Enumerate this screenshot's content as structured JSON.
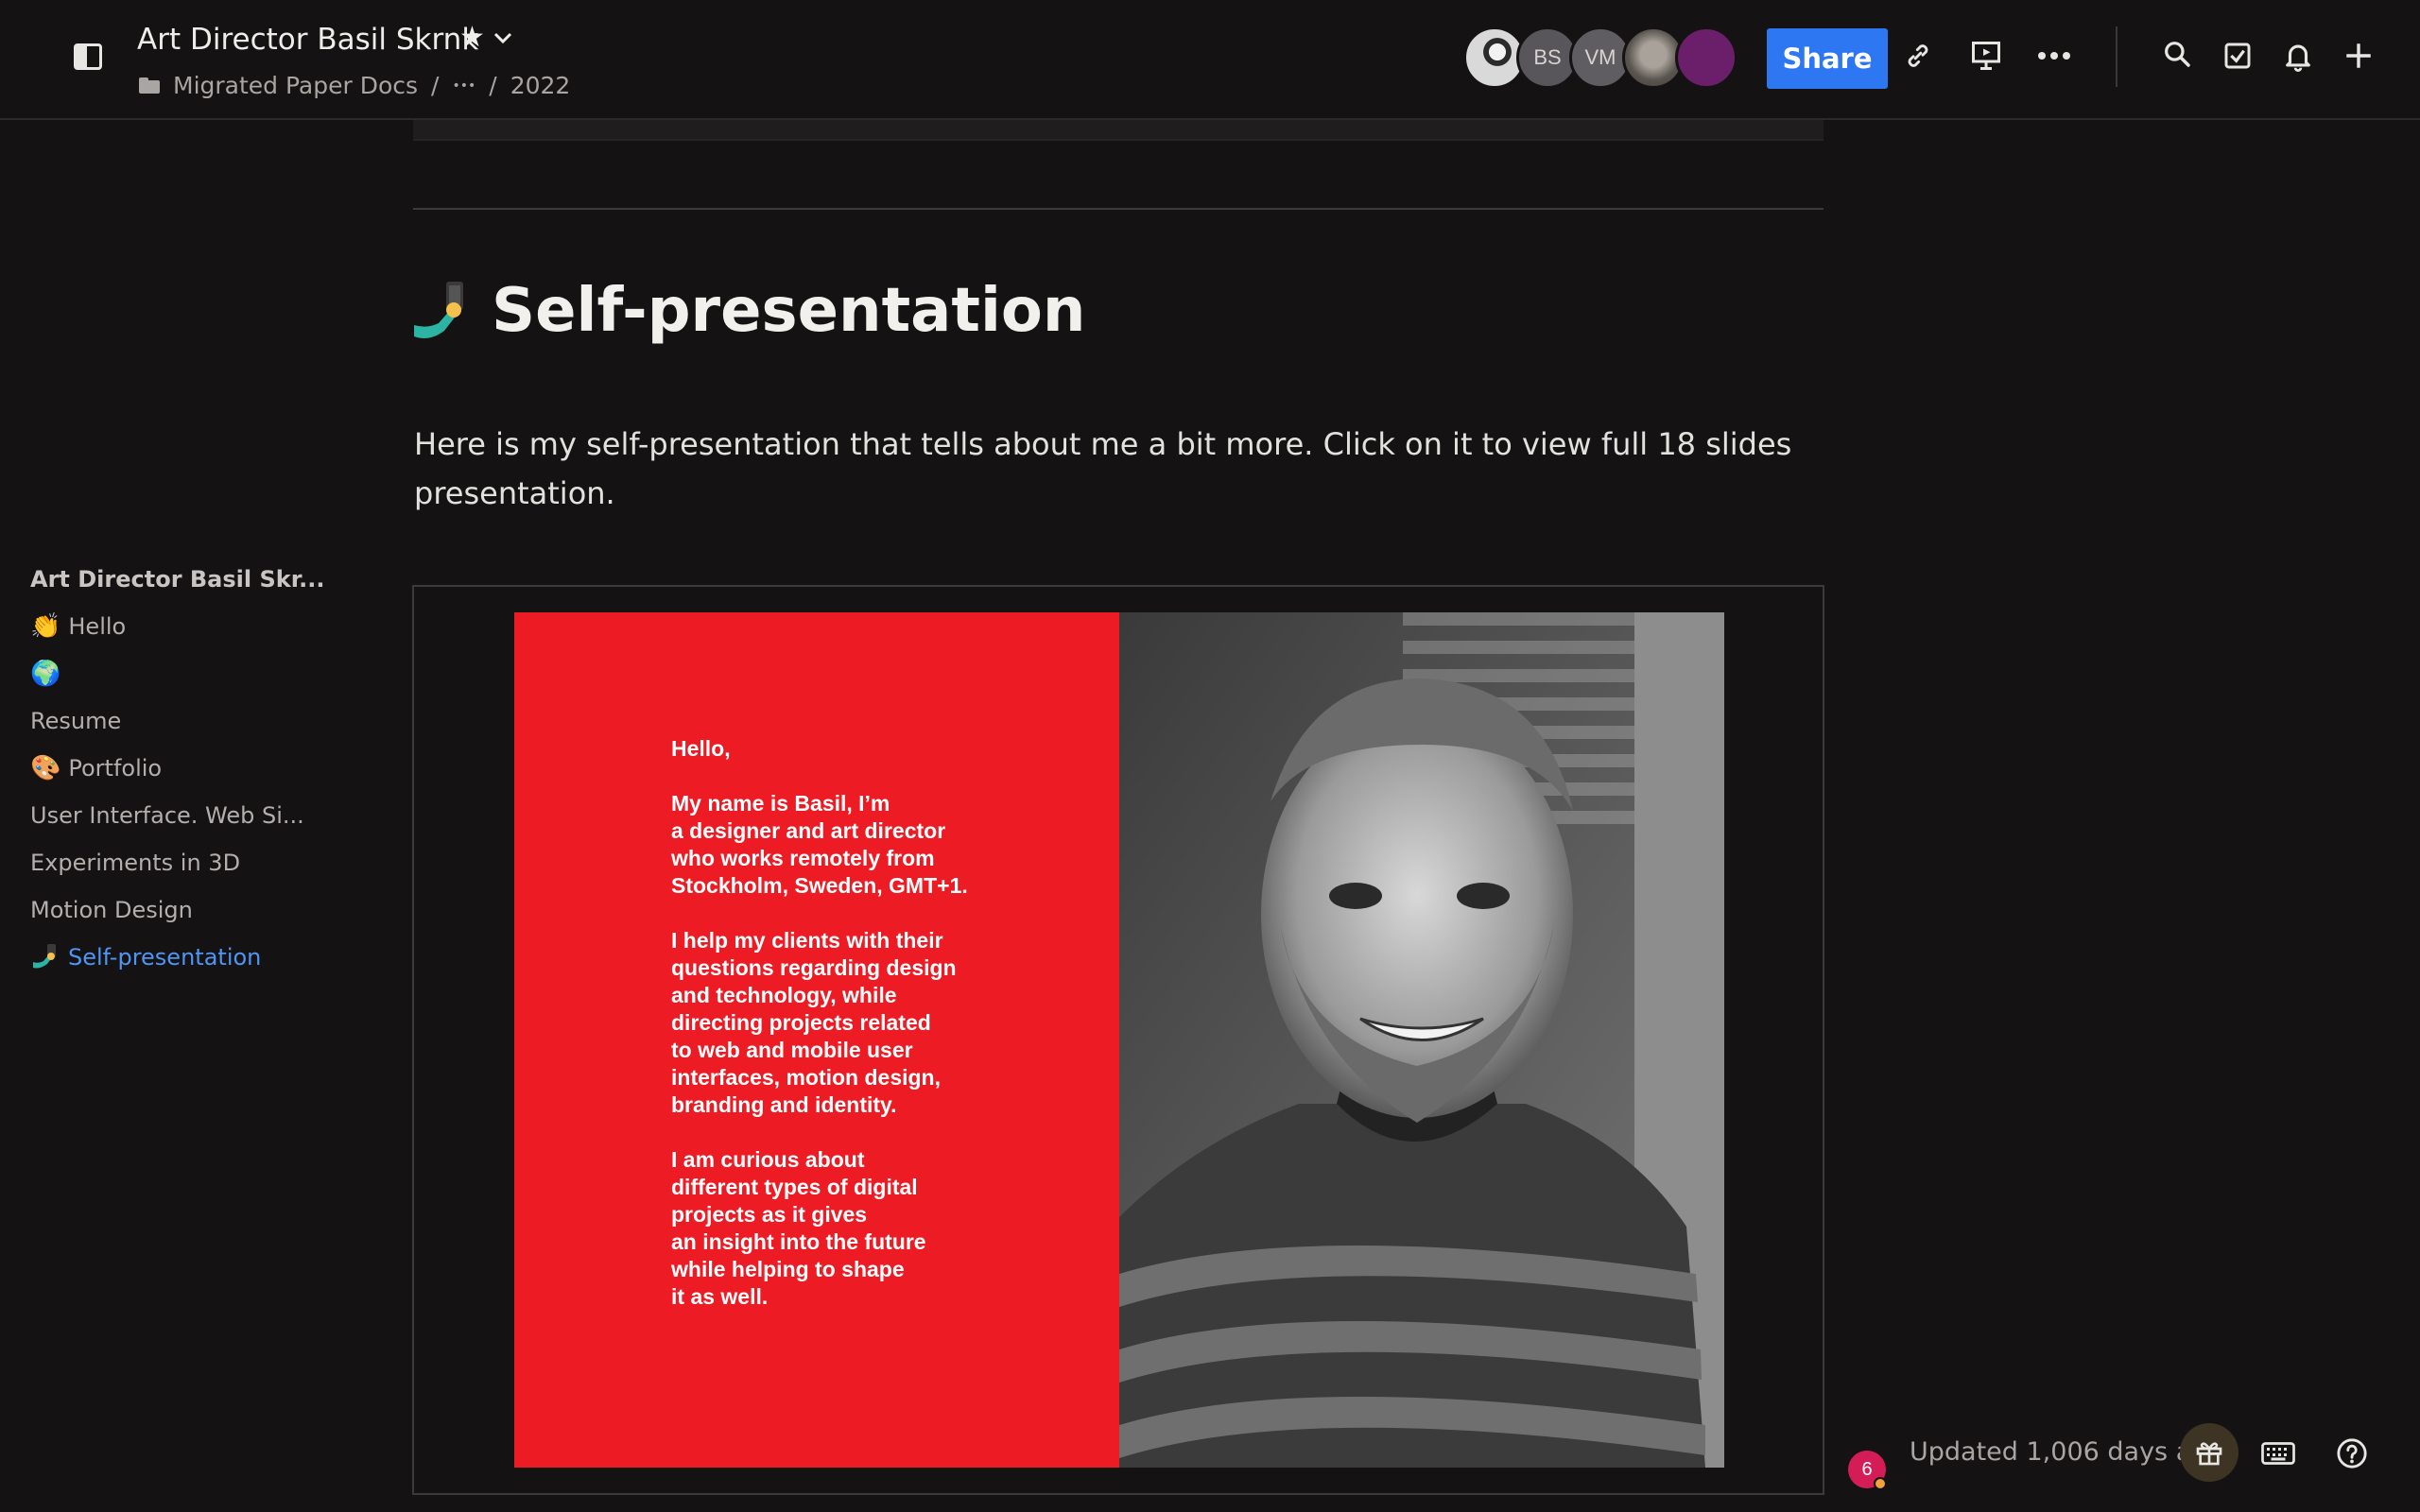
{
  "header": {
    "title": "Art Director Basil Skrnk",
    "breadcrumb": {
      "folder": "Migrated Paper Docs",
      "ellipsis": "•••",
      "separator": "/",
      "current": "2022"
    },
    "avatars": [
      {
        "initials": ""
      },
      {
        "initials": "BS"
      },
      {
        "initials": "VM"
      },
      {
        "initials": ""
      },
      {
        "initials": ""
      }
    ],
    "share_label": "Share",
    "icons": [
      "link-icon",
      "present-icon",
      "more-icon",
      "search-icon",
      "checklist-icon",
      "bell-icon",
      "plus-icon"
    ]
  },
  "nav": {
    "title": "Art Director Basil Skr...",
    "items": [
      {
        "emoji": "👏",
        "label": "Hello"
      },
      {
        "emoji": "🌍",
        "label": ""
      },
      {
        "emoji": "",
        "label": "Resume"
      },
      {
        "emoji": "🎨",
        "label": "Portfolio"
      },
      {
        "emoji": "",
        "label": "User Interface. Web Si..."
      },
      {
        "emoji": "",
        "label": "Experiments in 3D"
      },
      {
        "emoji": "",
        "label": "Motion Design"
      },
      {
        "emoji": "",
        "label": "Self-presentation"
      }
    ]
  },
  "main": {
    "heading": "Self-presentation",
    "paragraph": "Here is my self-presentation that tells about me a bit more. Click on it to view full 18 slides presentation.",
    "slide_text": "Hello,\n\nMy name is Basil, I’m\na designer and art director\nwho works remotely from\nStockholm, Sweden, GMT+1.\n\nI help my clients with their\nquestions regarding design\nand technology, while\ndirecting projects related\nto web and mobile user\ninterfaces, motion design,\nbranding and identity.\n\nI am curious about\ndifferent types of digital\nprojects as it gives\nan insight into the future\nwhile helping to shape\nit as well."
  },
  "footer": {
    "notification_count": "6",
    "updated": "Updated 1,006 days a"
  },
  "colors": {
    "background": "#141213",
    "accent": "#2e77f2",
    "active_link": "#4f95f5",
    "slide_red": "#ed1b24"
  }
}
